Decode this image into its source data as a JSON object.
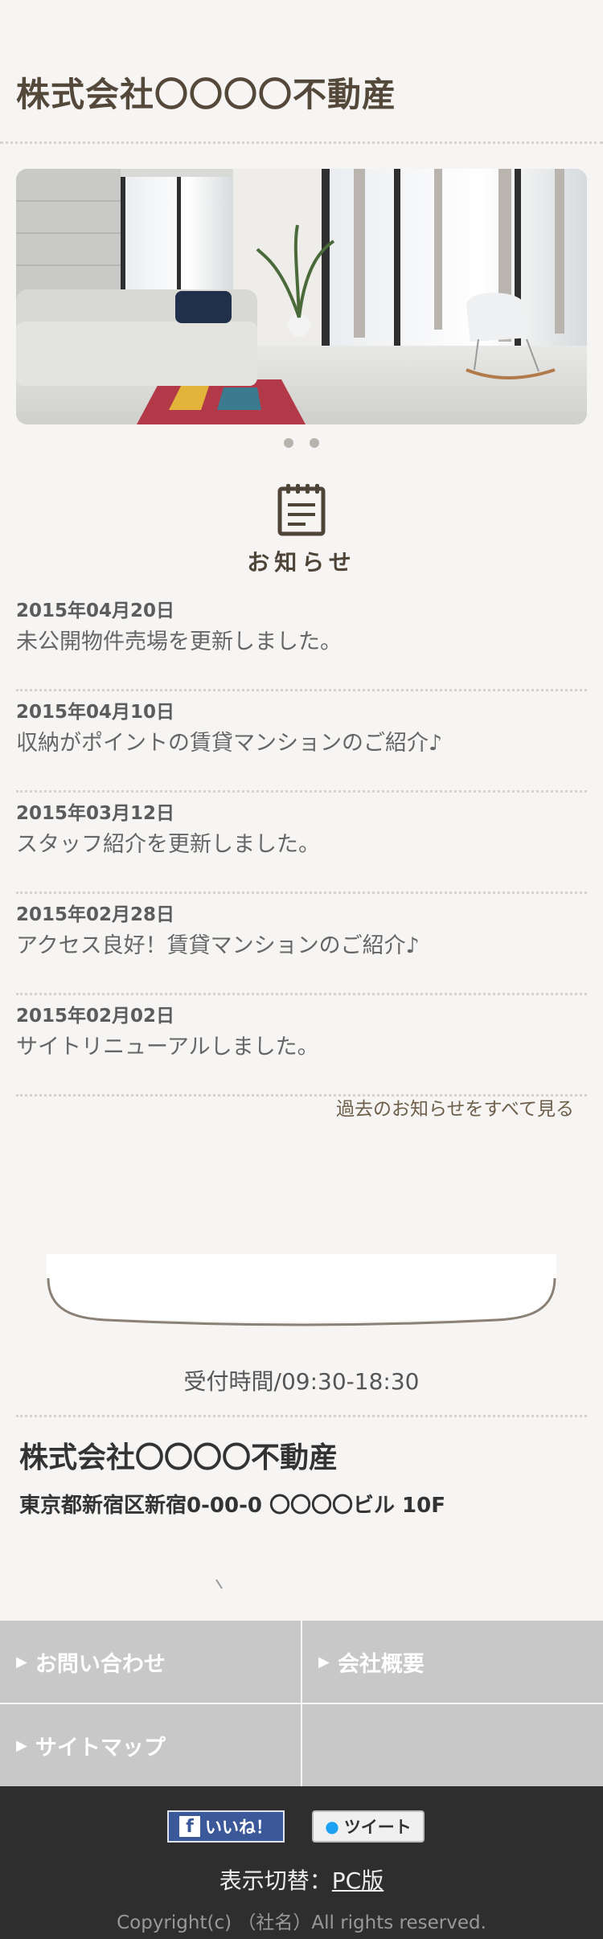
{
  "site": {
    "title": "株式会社〇〇〇〇不動産"
  },
  "news": {
    "heading": "お知らせ",
    "items": [
      {
        "date": "2015年04月20日",
        "text": "未公開物件売場を更新しました。"
      },
      {
        "date": "2015年04月10日",
        "text": "収納がポイントの賃貸マンションのご紹介♪"
      },
      {
        "date": "2015年03月12日",
        "text": "スタッフ紹介を更新しました。"
      },
      {
        "date": "2015年02月28日",
        "text": "アクセス良好！賃貸マンションのご紹介♪"
      },
      {
        "date": "2015年02月02日",
        "text": "サイトリニューアルしました。"
      }
    ],
    "more_link": "過去のお知らせをすべて見る"
  },
  "contact": {
    "hours": "受付時間/09:30-18:30",
    "company_name": "株式会社〇〇〇〇不動産",
    "address": "東京都新宿区新宿0-00-0 〇〇〇〇ビル 10F"
  },
  "nav": {
    "items": [
      {
        "label": "お問い合わせ"
      },
      {
        "label": "会社概要"
      },
      {
        "label": "サイトマップ"
      }
    ]
  },
  "footer": {
    "like_label": "いいね！",
    "tweet_label": "ツイート",
    "switch_label": "表示切替：",
    "switch_link": "PC版",
    "copyright": "Copyright(c) （社名）All rights reserved."
  },
  "colors": {
    "background": "#f6f5f3",
    "brand_text": "#54483a",
    "nav_bg": "#c9c8c9",
    "footer_bg": "#2e2e2e"
  }
}
